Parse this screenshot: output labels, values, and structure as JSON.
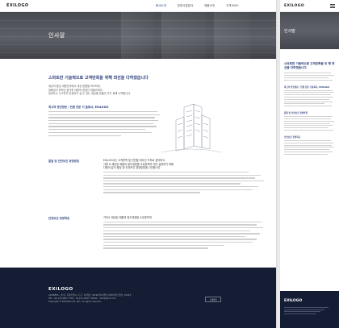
{
  "brand": {
    "logo": "EXILOGO"
  },
  "nav": {
    "items": [
      "회사소개",
      "분양사업분야",
      "제품소개",
      "고객서비스"
    ]
  },
  "banner": {
    "title": "인사말"
  },
  "intro": {
    "heading": "스마트한 기술력으로 고객만족을 위해 최선을 다하겠습니다",
    "lines": [
      "세상의 중심 대한민국에서 세상 방향을 모으하여,",
      "밀폐성이 뛰어난 밝가운 대한미 한방인 대들어미다.",
      "당새도소 누구든지 안심하고 살 수 있는 세상을 만들어 가기 위해 노력합니다."
    ]
  },
  "ceo": {
    "title": "최고의 방진창문 / 연결 전문 기 술회사, EXILOGO"
  },
  "sections": [
    {
      "heading": "품질 및 안전보건 경영방침",
      "lines": [
        "EXILOGO는 고객만족 및 안전을 최우선 가치로 생각하고,",
        "사원 & 제공된 제품과 정도경영을 소유준하여 이를 실현하기 위해",
        "다음과 같이 품질 및 안전보건 경영방침을 선언합니다."
      ]
    },
    {
      "heading": "안전보건 경영목표",
      "lines": [
        "가치소 제공된 제품과 정도경영을 소유준하여"
      ]
    }
  ],
  "footer": {
    "logo": "EXILOGO",
    "lines": [
      "ADDRESS : 경기도 서울특별시 구로구 디지털로 ###(미디어빌딩) 에이바이오빌딩, 1004호",
      "TEL : 02-123-4567 / FAX : 02-123-4567 / EMAIL : 123@abcd.com",
      "Copyright © EXILOGO CO.,LTD. All rights reserved."
    ],
    "button": "고객센터"
  },
  "mobile": {
    "logo": "EXILOGO",
    "banner_title": "인사말",
    "heading": "스마트한 기술력으로 고객만족을 위 해 최선을 다하겠습니다",
    "sub1": "최고의 방진창문 / 연결 전문 기술회사, EXILOGO",
    "sub2": "품질 및 안전보건 경영방침",
    "sub3": "안전보건 경영목표",
    "footer_logo": "EXILOGO"
  }
}
